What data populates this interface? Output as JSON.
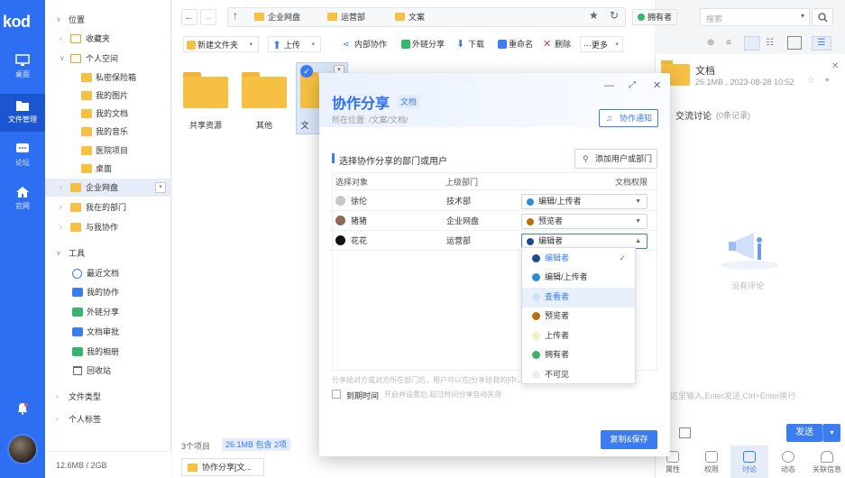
{
  "app": {
    "logo": "kod"
  },
  "rail": [
    {
      "label": "桌面"
    },
    {
      "label": "文件管理"
    },
    {
      "label": "论坛"
    },
    {
      "label": "官网"
    }
  ],
  "tree": {
    "location": "位置",
    "favorites": "收藏夹",
    "personal": "个人空间",
    "personal_children": [
      "私密保险箱",
      "我的图片",
      "我的文档",
      "我的音乐",
      "医院项目",
      "桌面"
    ],
    "enterprise": "企业网盘",
    "my_dept": "我在的部门",
    "collab_with_me": "与我协作",
    "tools": "工具",
    "tool_items": [
      "最近文档",
      "我的协作",
      "外链分享",
      "文档审批",
      "我的相册",
      "回收站"
    ],
    "file_types": "文件类型",
    "tags": "个人标签",
    "storage": "12.6MB / 2GB"
  },
  "breadcrumb": [
    "企业网盘",
    "运营部",
    "文案"
  ],
  "search": {
    "placeholder": "搜索",
    "owner_badge": "拥有者"
  },
  "toolbar": {
    "new_folder": "新建文件夹",
    "upload": "上传",
    "internal_collab": "内部协作",
    "external_share": "外链分享",
    "download": "下载",
    "rename": "重命名",
    "delete": "删除",
    "more": "···更多"
  },
  "folders": [
    {
      "name": "共享资源"
    },
    {
      "name": "其他"
    },
    {
      "name": "文"
    }
  ],
  "status": {
    "count": "3个项目",
    "size": "26.1MB 包含 2项"
  },
  "taskbar_item": "协作分享[文...",
  "right_panel": {
    "title": "文档",
    "meta": "26.1MB , 2023-08-28 10:52",
    "discussion": "交流讨论",
    "records": "(0条记录)",
    "empty": "没有评论",
    "hint": "这里输入,Enter发送,Ctrl+Enter换行",
    "send": "发送",
    "tabs": [
      "属性",
      "权限",
      "讨论",
      "动态",
      "关联信息"
    ]
  },
  "dialog": {
    "title": "协作分享",
    "tag": "文档",
    "path": "所在位置: /文案/文档/",
    "notify": "协作通知",
    "section": "选择协作分享的部门或用户",
    "add": "添加用户或部门",
    "columns": [
      "选择对象",
      "上级部门",
      "文档权限"
    ],
    "rows": [
      {
        "name": "徐伦",
        "dept": "技术部",
        "perm": "编辑/上传者",
        "color": "#2b8fd8"
      },
      {
        "name": "猪猪",
        "dept": "企业网盘",
        "perm": "预览者",
        "color": "#b86e0c"
      },
      {
        "name": "花花",
        "dept": "运营部",
        "perm": "编辑者",
        "color": "#1f4b8c"
      }
    ],
    "note": "分享给对方或对方所在部门后，用户可以在[分享给我的]中...",
    "expire_label": "到期时间",
    "expire_hint": "开启并设置后,超过时间分享自动失效",
    "save": "复制&保存"
  },
  "dropdown": [
    {
      "label": "编辑者",
      "color": "#1f4b8c",
      "selected": true
    },
    {
      "label": "编辑/上传者",
      "color": "#2b8fd8"
    },
    {
      "label": "查看者",
      "color": "#cfe3f7",
      "hover": true
    },
    {
      "label": "预览者",
      "color": "#b86e0c"
    },
    {
      "label": "上传者",
      "color": "#f7ecc9"
    },
    {
      "label": "拥有者",
      "color": "#3bb36b"
    },
    {
      "label": "不可见",
      "color": "#efefef"
    }
  ]
}
